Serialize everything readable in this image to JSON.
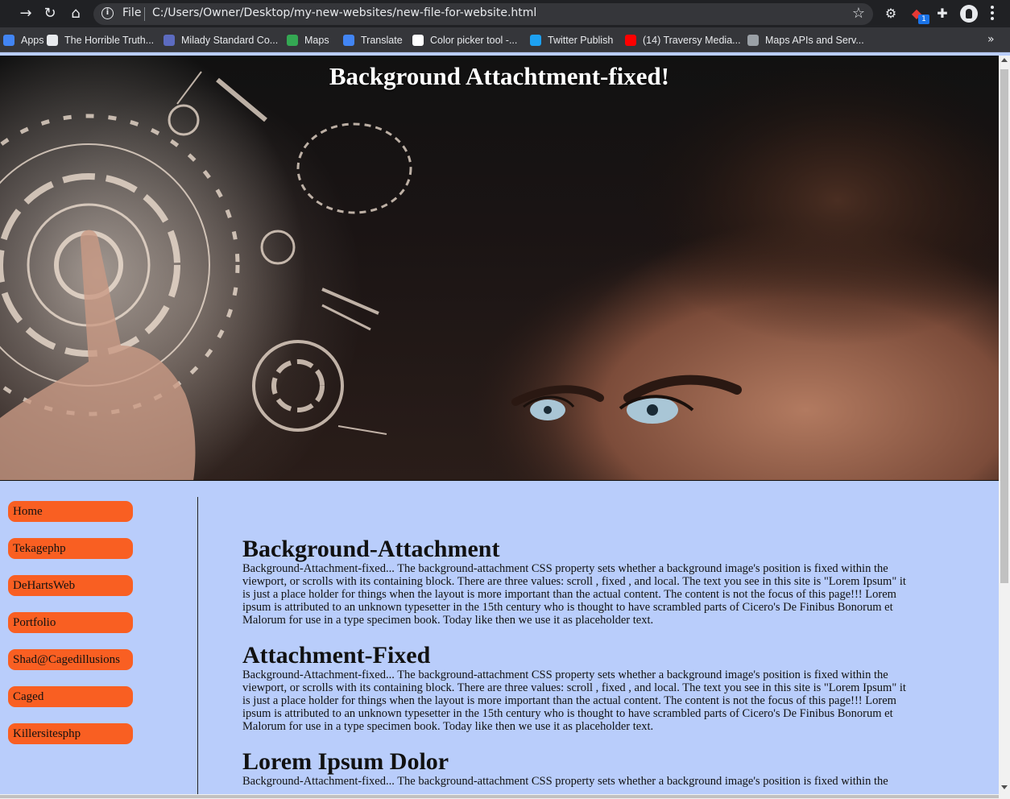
{
  "browser": {
    "url_scheme": "File",
    "url": "C:/Users/Owner/Desktop/my-new-websites/new-file-for-website.html",
    "extension_badge": "1",
    "bookmarks": [
      {
        "label": "Apps",
        "icon": "apps-grid-icon",
        "color": "#4285f4"
      },
      {
        "label": "The Horrible Truth...",
        "icon": "globe-icon",
        "color": "#e8eaed"
      },
      {
        "label": "Milady Standard Co...",
        "icon": "q-logo-icon",
        "color": "#5c6bc0"
      },
      {
        "label": "Maps",
        "icon": "maps-pin-icon",
        "color": "#34a853"
      },
      {
        "label": "Translate",
        "icon": "translate-icon",
        "color": "#4285f4"
      },
      {
        "label": "Color picker tool -...",
        "icon": "color-picker-icon",
        "color": "#ffffff"
      },
      {
        "label": "Twitter Publish",
        "icon": "twitter-icon",
        "color": "#1da1f2"
      },
      {
        "label": "(14) Traversy Media...",
        "icon": "youtube-icon",
        "color": "#ff0000"
      },
      {
        "label": "Maps APIs and Serv...",
        "icon": "gear-icon",
        "color": "#9aa0a6"
      }
    ]
  },
  "hero": {
    "title": "Background Attachtment-fixed!"
  },
  "nav": {
    "accent_color": "#f95f22",
    "items": [
      "Home",
      "Tekagephp",
      "DeHartsWeb",
      "Portfolio",
      "Shad@Cagedillusions",
      "Caged",
      "Killersitesphp"
    ]
  },
  "articles": [
    {
      "heading": "Background-Attachment",
      "lines": [
        "Background-Attachment-fixed... The background-attachment CSS property sets whether a background image's position is fixed within the",
        "viewport, or scrolls with its containing block. There are three values: scroll , fixed , and local. The text you see in this site is \"Lorem Ipsum\" it",
        "is just a place holder for things when the layout is more important than the actual content. The content is not the focus of this page!!! Lorem",
        "ipsum is attributed to an unknown typesetter in the 15th century who is thought to have scrambled parts of Cicero's De Finibus Bonorum et",
        "Malorum for use in a type specimen book. Today like then we use it as placeholder text."
      ]
    },
    {
      "heading": "Attachment-Fixed",
      "lines": [
        "Background-Attachment-fixed... The background-attachment CSS property sets whether a background image's position is fixed within the",
        "viewport, or scrolls with its containing block. There are three values: scroll , fixed , and local. The text you see in this site is \"Lorem Ipsum\" it",
        "is just a place holder for things when the layout is more important than the actual content. The content is not the focus of this page!!! Lorem",
        "ipsum is attributed to an unknown typesetter in the 15th century who is thought to have scrambled parts of Cicero's De Finibus Bonorum et",
        "Malorum for use in a type specimen book. Today like then we use it as placeholder text."
      ]
    },
    {
      "heading": "Lorem Ipsum Dolor",
      "lines": [
        "Background-Attachment-fixed... The background-attachment CSS property sets whether a background image's position is fixed within the"
      ]
    }
  ]
}
